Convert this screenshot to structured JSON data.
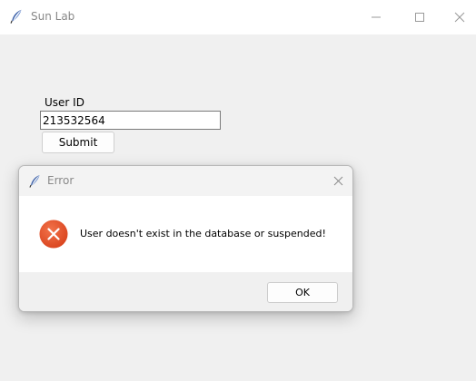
{
  "window": {
    "title": "Sun Lab"
  },
  "form": {
    "userid_label": "User ID",
    "userid_value": "213532564",
    "submit_label": "Submit"
  },
  "dialog": {
    "title": "Error",
    "message": "User doesn't exist in the database or suspended!",
    "ok_label": "OK",
    "icon": "error-icon"
  },
  "colors": {
    "error_red": "#e4502a",
    "window_bg": "#f0f0f0",
    "titlebar_text": "#888888"
  }
}
